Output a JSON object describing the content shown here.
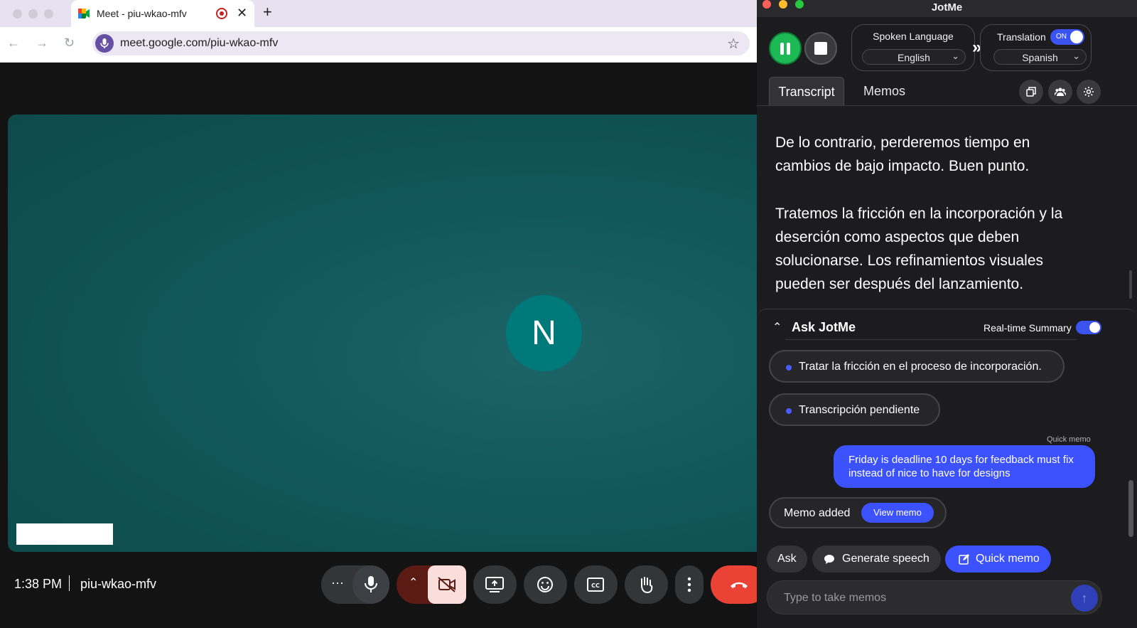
{
  "browser": {
    "tab_title": "Meet - piu-wkao-mfv",
    "tab_close": "✕",
    "new_tab": "+",
    "url": "meet.google.com/piu-wkao-mfv",
    "star": "☆",
    "back": "←",
    "forward": "→",
    "reload": "↻"
  },
  "meet": {
    "avatar_letter": "N",
    "time": "1:38 PM",
    "meeting_code": "piu-wkao-mfv",
    "more_dots": "···"
  },
  "jotme": {
    "app_title": "JotMe",
    "spoken_language_label": "Spoken Language",
    "spoken_language_value": "English",
    "translation_label": "Translation",
    "translation_toggle": "ON",
    "translation_language_value": "Spanish",
    "arrow": "»",
    "chevron": "⌄",
    "tabs": {
      "transcript": "Transcript",
      "memos": "Memos"
    },
    "transcript": [
      "De lo contrario, perderemos tiempo en cambios de bajo impacto. Buen punto.",
      "Tratemos la fricción en la incorporación y la deserción como aspectos que deben solucionarse. Los refinamientos visuales pueden ser después del lanzamiento."
    ],
    "ask": {
      "chevron": "⌃",
      "title": "Ask JotMe",
      "realtime_label": "Real-time Summary",
      "suggestions": [
        "Tratar la fricción en el proceso de incorporación.",
        "Transcripción pendiente"
      ],
      "quick_memo_label": "Quick memo",
      "quick_memo_text": "Friday is deadline 10 days for feedback must fix instead of nice to have for designs",
      "memo_added": "Memo added",
      "view_memo": "View memo"
    },
    "actions": {
      "ask": "Ask",
      "generate_speech": "Generate speech",
      "quick_memo": "Quick memo"
    },
    "input_placeholder": "Type to take memos",
    "send": "↑"
  },
  "colors": {
    "accent_blue": "#3d52ff",
    "record_green": "#1db954",
    "meet_tile": "#135a5c",
    "end_call_red": "#ea4335"
  }
}
